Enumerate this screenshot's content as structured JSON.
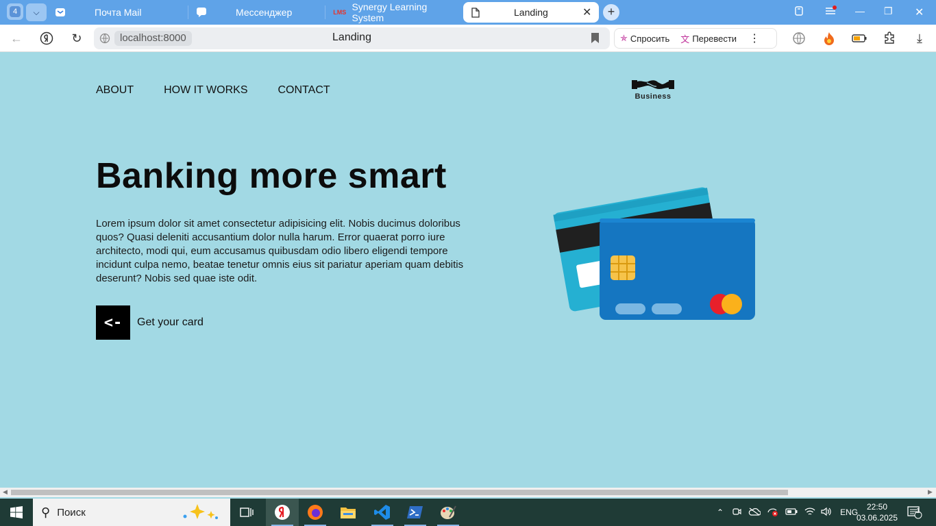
{
  "browser": {
    "tab_count": "4",
    "tabs": [
      {
        "title": "Почта Mail",
        "icon": "mail-icon"
      },
      {
        "title": "Мессенджер",
        "icon": "messenger-icon"
      },
      {
        "title": "Synergy Learning System",
        "icon": "lms-icon",
        "icon_text": "LMS"
      },
      {
        "title": "Landing",
        "icon": "document-icon",
        "active": true
      }
    ],
    "address": "localhost:8000",
    "page_title": "Landing",
    "actions": {
      "ask": "Спросить",
      "translate": "Перевести"
    }
  },
  "page": {
    "menu": [
      "ABOUT",
      "HOW IT WORKS",
      "CONTACT"
    ],
    "logo_text": "Business",
    "hero_title": "Banking more smart",
    "hero_text": "Lorem ipsum dolor sit amet consectetur adipisicing elit. Nobis ducimus doloribus quos? Quasi deleniti accusantium dolor nulla harum. Error quaerat porro iure architecto, modi qui, eum accusamus quibusdam odio libero eligendi tempore incidunt culpa nemo, beatae tenetur omnis eius sit pariatur aperiam quam debitis deserunt? Nobis sed quae iste odit.",
    "cta_symbol": "<-",
    "cta_label": "Get your card"
  },
  "taskbar": {
    "search_placeholder": "Поиск",
    "language": "ENG",
    "time": "22:50",
    "date": "03.06.2025",
    "notifications": "1"
  },
  "colors": {
    "page_bg": "#a2d9e4",
    "tabbar_bg": "#5fa3e8",
    "taskbar_bg": "#1f3b36",
    "card_front": "#1576c1",
    "card_back": "#25b0d2"
  }
}
